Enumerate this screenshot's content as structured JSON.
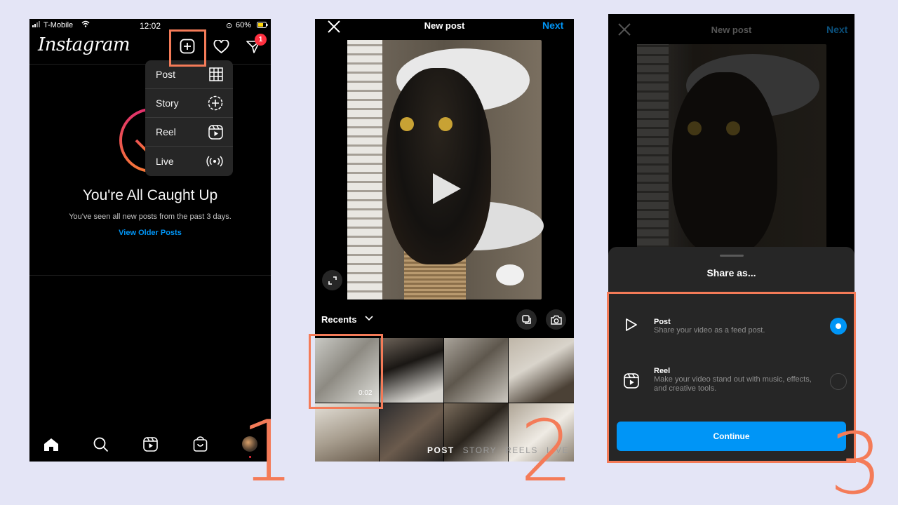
{
  "colors": {
    "accent": "#f47b58",
    "link": "#0095f6",
    "notif": "#ff3040",
    "background": "#e4e5f6"
  },
  "phone1": {
    "carrier": "T-Mobile",
    "time": "12:02",
    "battery": "60%",
    "logo": "Instagram",
    "notification_count": "1",
    "menu": [
      {
        "label": "Post",
        "icon": "grid-icon"
      },
      {
        "label": "Story",
        "icon": "story-plus-icon"
      },
      {
        "label": "Reel",
        "icon": "reel-icon"
      },
      {
        "label": "Live",
        "icon": "live-broadcast-icon"
      }
    ],
    "caught_up_title": "You're All Caught Up",
    "caught_up_sub": "You've seen all new posts from the past 3 days.",
    "older_link": "View Older Posts"
  },
  "phone2": {
    "title": "New post",
    "next": "Next",
    "recents": "Recents",
    "video_duration": "0:02",
    "tabs": [
      "POST",
      "STORY",
      "REELS",
      "LIVE"
    ],
    "active_tab": "POST"
  },
  "phone3": {
    "title": "New post",
    "next": "Next",
    "share_as": "Share as...",
    "options": [
      {
        "title": "Post",
        "desc": "Share your video as a feed post.",
        "selected": true
      },
      {
        "title": "Reel",
        "desc": "Make your video stand out with music, effects, and creative tools.",
        "selected": false
      }
    ],
    "continue": "Continue"
  },
  "steps": [
    "1",
    "2",
    "3"
  ]
}
